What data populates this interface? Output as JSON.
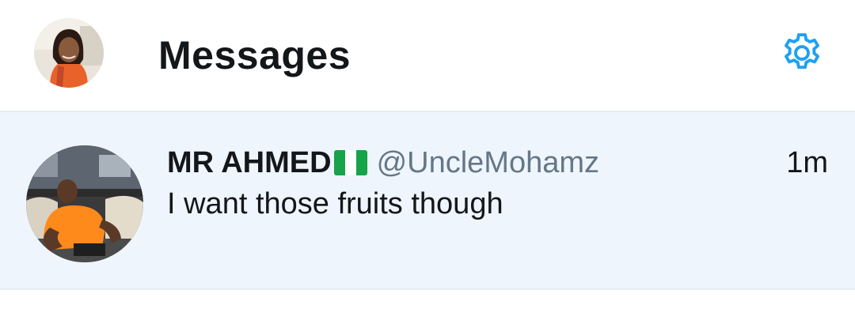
{
  "header": {
    "title": "Messages",
    "avatar_icon": "user-avatar",
    "settings_icon": "gear-icon",
    "accent_color": "#1da1f2"
  },
  "conversations": [
    {
      "name": "MR AHMED",
      "flag_icon": "nigeria-flag-icon",
      "handle": "@UncleMohamz",
      "time": "1m",
      "preview": "I want those fruits though",
      "avatar_icon": "contact-avatar",
      "row_color": "#eef5fc"
    }
  ]
}
